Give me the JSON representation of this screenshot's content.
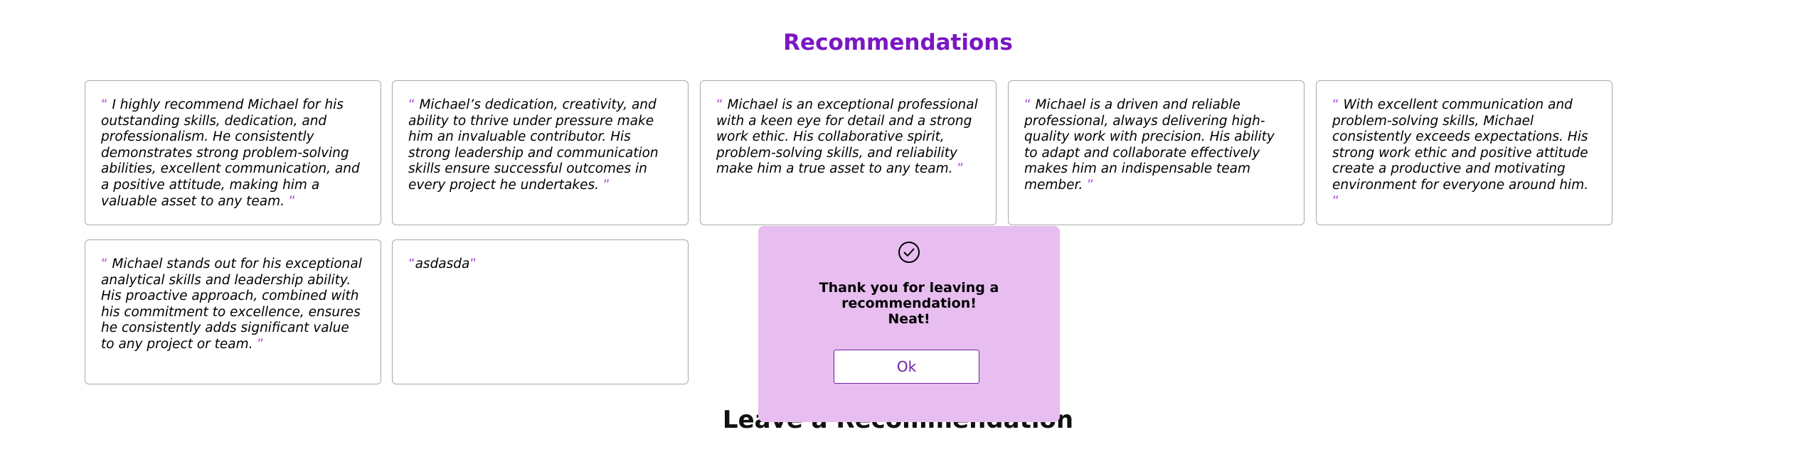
{
  "section": {
    "title": "Recommendations"
  },
  "recommendations": [
    {
      "open_quote": "“",
      "text": " I highly recommend Michael for his outstanding skills, dedication, and professionalism. He consistently demonstrates strong problem-solving abilities, excellent communication, and a positive attitude, making him a valuable asset to any team. ",
      "close_quote": "”"
    },
    {
      "open_quote": "“",
      "text": " Michael’s dedication, creativity, and ability to thrive under pressure make him an invaluable contributor. His strong leadership and communication skills ensure successful outcomes in every project he undertakes. ",
      "close_quote": "”"
    },
    {
      "open_quote": "“",
      "text": " Michael is an exceptional professional with a keen eye for detail and a strong work ethic. His collaborative spirit, problem-solving skills, and reliability make him a true asset to any team. ",
      "close_quote": "”"
    },
    {
      "open_quote": "“",
      "text": " Michael is a driven and reliable professional, always delivering high-quality work with precision. His ability to adapt and collaborate effectively makes him an indispensable team member. ",
      "close_quote": "”"
    },
    {
      "open_quote": "“",
      "text": " With excellent communication and problem-solving skills, Michael consistently exceeds expectations. His strong work ethic and positive attitude create a productive and motivating environment for everyone around him. ",
      "close_quote": "”"
    },
    {
      "open_quote": "“",
      "text": " Michael stands out for his exceptional analytical skills and leadership ability. His proactive approach, combined with his commitment to excellence, ensures he consistently adds significant value to any project or team. ",
      "close_quote": "”"
    },
    {
      "open_quote": "“",
      "text": "asdasda",
      "close_quote": "”"
    }
  ],
  "leave_section": {
    "heading": "Leave a Recommendation"
  },
  "modal": {
    "icon": "check-circle-icon",
    "message_line1": "Thank you for leaving a recommendation!",
    "message_line2": "Neat!",
    "ok_label": "Ok"
  },
  "colors": {
    "accent_purple": "#7a17c4",
    "quote_mark": "#b24bd7",
    "modal_background": "#e8bdf0",
    "button_border": "#6f1fa8"
  }
}
